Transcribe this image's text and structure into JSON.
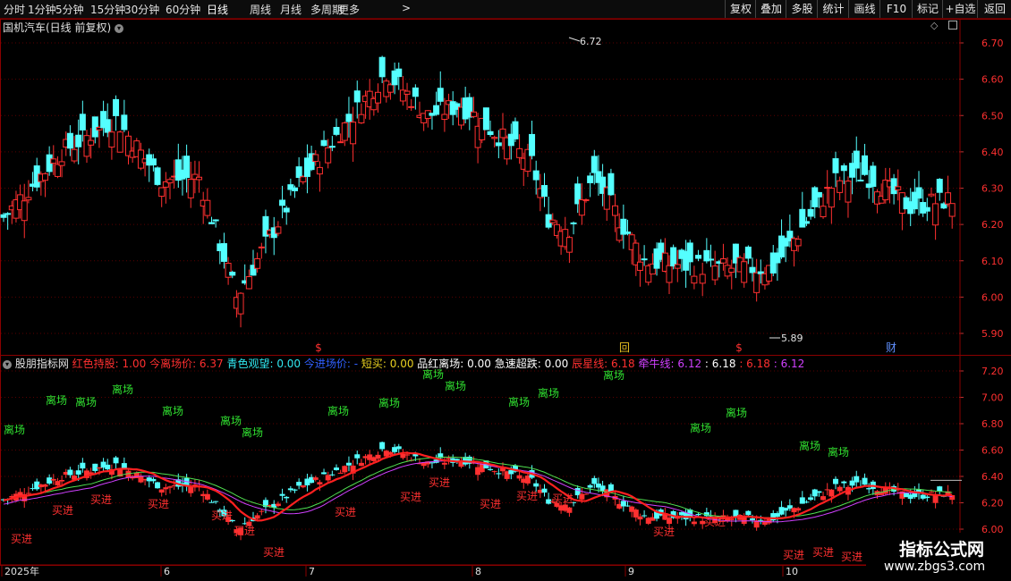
{
  "toolbar": {
    "left_items": [
      "分时",
      "1分钟",
      "5分钟",
      "15分钟",
      "30分钟",
      "60分钟",
      "日线",
      "周线",
      "月线",
      "多周期",
      "更多"
    ],
    "active_item": "日线",
    "more_arrow": ">",
    "right_items": [
      "复权",
      "叠加",
      "多股",
      "统计",
      "画线",
      "F10",
      "标记",
      "+自选",
      "返回"
    ]
  },
  "main_panel": {
    "title": "国机汽车(日线 前复权)",
    "high_label": "6.72",
    "low_label": "5.89",
    "price_ticks": [
      "6.70",
      "6.60",
      "6.50",
      "6.40",
      "6.30",
      "6.20",
      "6.10",
      "6.00",
      "5.90"
    ],
    "markers": [
      "$",
      "回",
      "$",
      "财"
    ],
    "top_right_icons": [
      "diamond-icon",
      "panel-icon"
    ]
  },
  "indicator_panel": {
    "name": "股朋指标网",
    "fields": [
      {
        "text": "红色持股: 1.00",
        "color": "#ff3030"
      },
      {
        "text": "今离场价: 6.37",
        "color": "#ff3030"
      },
      {
        "text": "青色观望: 0.00",
        "color": "#30e8f0"
      },
      {
        "text": "今进场价: -",
        "color": "#3060ff"
      },
      {
        "text": "短买: 0.00",
        "color": "#e8d020"
      },
      {
        "text": "品红离场: 0.00",
        "color": "#ffffff"
      },
      {
        "text": "急速超跌: 0.00",
        "color": "#ffffff"
      },
      {
        "text": "辰星线: 6.18",
        "color": "#ff3030"
      },
      {
        "text": "牵牛线: 6.12",
        "color": "#d040ff"
      },
      {
        "text": ": 6.18",
        "color": "#ffffff"
      },
      {
        "text": ": 6.18",
        "color": "#ff3030"
      },
      {
        "text": ": 6.12",
        "color": "#d040ff"
      }
    ],
    "price_ticks": [
      "7.20",
      "7.00",
      "6.80",
      "6.60",
      "6.40",
      "6.20",
      "6.00"
    ],
    "sell_label": "离场",
    "buy_label": "买进",
    "sell_count": 24,
    "buy_count": 19
  },
  "date_axis": {
    "labels": [
      "2025年",
      "6",
      "7",
      "8",
      "9",
      "10"
    ]
  },
  "watermark": {
    "title": "指标公式网",
    "url": "www.zbgs3.com"
  },
  "colors": {
    "up": "#ff3030",
    "down": "#54ffff",
    "frame": "#8a0000",
    "sell_text": "#30e030",
    "buy_text": "#ff3030"
  }
}
